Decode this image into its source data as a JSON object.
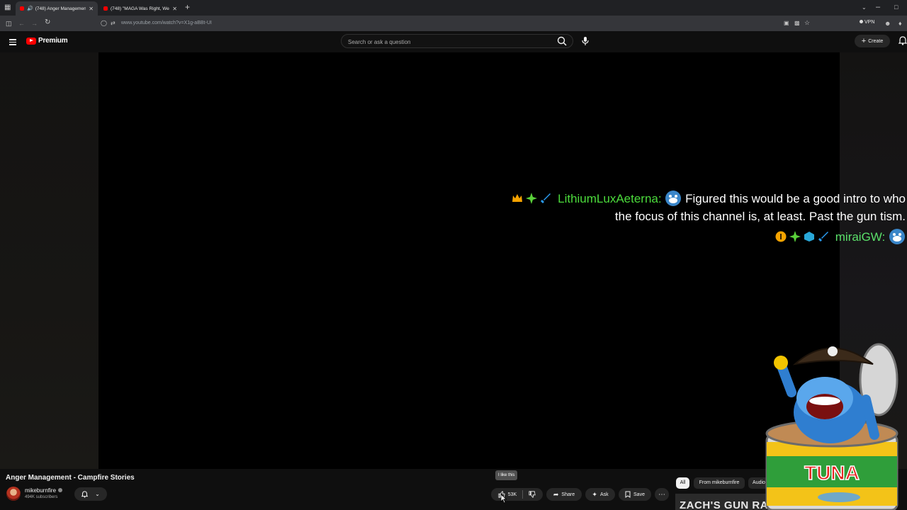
{
  "browser": {
    "tabs": [
      {
        "title": "(748) Anger Management -",
        "active": true
      },
      {
        "title": "(748) \"MAGA Was Right, We W",
        "active": false
      }
    ],
    "url_host": "www.youtube.com",
    "url_path": "/watch?v=X1g-aBBt-UI",
    "vpn_label": "VPN"
  },
  "header": {
    "logo_text": "Premium",
    "search_placeholder": "Search or ask a question",
    "create_label": "Create"
  },
  "chat": [
    {
      "user": "LithiumLuxAeterna:",
      "text_line1": "Figured this would be a good intro to who",
      "text_line2": "the focus of this channel is, at least. Past the gun tism."
    },
    {
      "user": "miraiGW:"
    }
  ],
  "video": {
    "title": "Anger Management - Campfire Stories",
    "channel": "mikeburnfire",
    "subscribers": "494K subscribers",
    "like_count": "53K",
    "tooltip": "I like this",
    "share_label": "Share",
    "ask_label": "Ask",
    "save_label": "Save"
  },
  "recommendations": {
    "chips": [
      "All",
      "From mikeburnfire",
      "Audio"
    ],
    "thumbnail_text": "ZACH'S GUN RANT"
  },
  "sticker_text": "TUNA",
  "colors": {
    "brand_red": "#ff0000",
    "chat_name": "#4cdb3c",
    "background": "#0f0f0f"
  }
}
